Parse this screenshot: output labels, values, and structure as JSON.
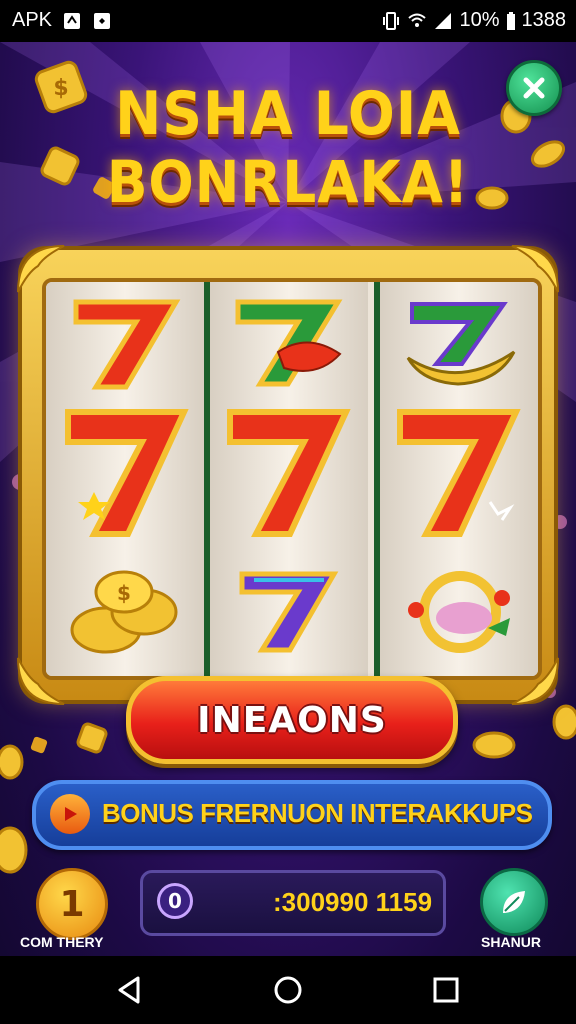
{
  "status_bar": {
    "app_label": "APK",
    "battery": "10%",
    "time": "1388"
  },
  "game": {
    "title_line1": "NSHA LOIA",
    "title_line2": "BONRLAKA!",
    "close_button": "close-icon",
    "reels": [
      [
        "red-7",
        "red-7",
        "gold-coins"
      ],
      [
        "green-7-chili",
        "red-7",
        "purple-7"
      ],
      [
        "green-7-banana",
        "red-7",
        "fruit-ring"
      ]
    ],
    "spin_button": "INEAONS",
    "bonus_bar": "BONUS FRERNUON INTERAKKUPS",
    "bottom_left_label": "COM THERY",
    "balance_value": ":300990 1159",
    "bottom_right_label": "SHANUR",
    "colors": {
      "title": "#ffd21a",
      "spin": "#e8201a",
      "bonus_bar": "#1e4fb4",
      "frame_gold": "#e8b030"
    }
  },
  "nav_bar": {
    "back": "back-icon",
    "home": "home-icon",
    "recents": "recents-icon"
  }
}
